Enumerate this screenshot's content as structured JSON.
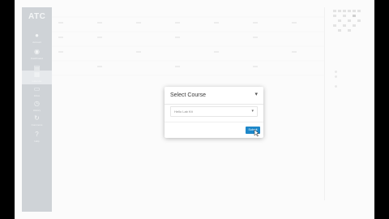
{
  "sidebar": {
    "logo": "ATC",
    "items": [
      {
        "label": "Account",
        "icon": "user-icon"
      },
      {
        "label": "Dashboard",
        "icon": "dashboard-icon"
      },
      {
        "label": "Courses",
        "icon": "book-icon"
      },
      {
        "label": "Calendar",
        "icon": "calendar-icon",
        "active": true
      },
      {
        "label": "Inbox",
        "icon": "inbox-icon"
      },
      {
        "label": "History",
        "icon": "clock-icon"
      },
      {
        "label": "Commons",
        "icon": "commons-icon"
      },
      {
        "label": "Help",
        "icon": "help-icon"
      }
    ]
  },
  "modal": {
    "title": "Select Course",
    "close_label": "▾",
    "select_value": "Hello Lab Kit",
    "select_caret": "▾",
    "submit_label": "Submit"
  },
  "colors": {
    "sidebar_bg": "#cfd3d7",
    "accent": "#1d87c9"
  }
}
